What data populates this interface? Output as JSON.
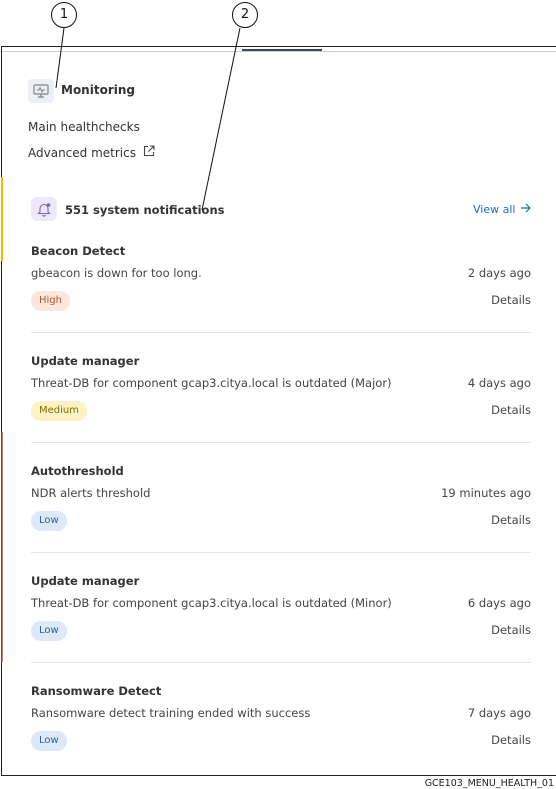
{
  "callouts": [
    "1",
    "2"
  ],
  "monitoring": {
    "title": "Monitoring",
    "icon": "monitor-icon",
    "links": [
      "Main healthchecks",
      "Advanced metrics"
    ]
  },
  "notifications": {
    "title": "551 system notifications",
    "view_all": "View all",
    "items": [
      {
        "source": "Beacon Detect",
        "message": "gbeacon is down for too long.",
        "time": "2 days ago",
        "severity": "High",
        "details": "Details"
      },
      {
        "source": "Update manager",
        "message": "Threat-DB for component gcap3.citya.local is outdated (Major)",
        "time": "4 days ago",
        "severity": "Medium",
        "details": "Details"
      },
      {
        "source": "Autothreshold",
        "message": "NDR alerts threshold",
        "time": "19 minutes ago",
        "severity": "Low",
        "details": "Details"
      },
      {
        "source": "Update manager",
        "message": "Threat-DB for component gcap3.citya.local is outdated (Minor)",
        "time": "6 days ago",
        "severity": "Low",
        "details": "Details"
      },
      {
        "source": "Ransomware Detect",
        "message": "Ransomware detect training ended with success",
        "time": "7 days ago",
        "severity": "Low",
        "details": "Details"
      }
    ]
  },
  "colors": {
    "link": "#1f6fbf",
    "high_bg": "#fde7dc",
    "high_fg": "#b4592a",
    "medium_bg": "#fdf2c4",
    "medium_fg": "#8a6a00",
    "low_bg": "#dde9f8",
    "low_fg": "#2d5f99"
  },
  "footer": "GCE103_MENU_HEALTH_01"
}
